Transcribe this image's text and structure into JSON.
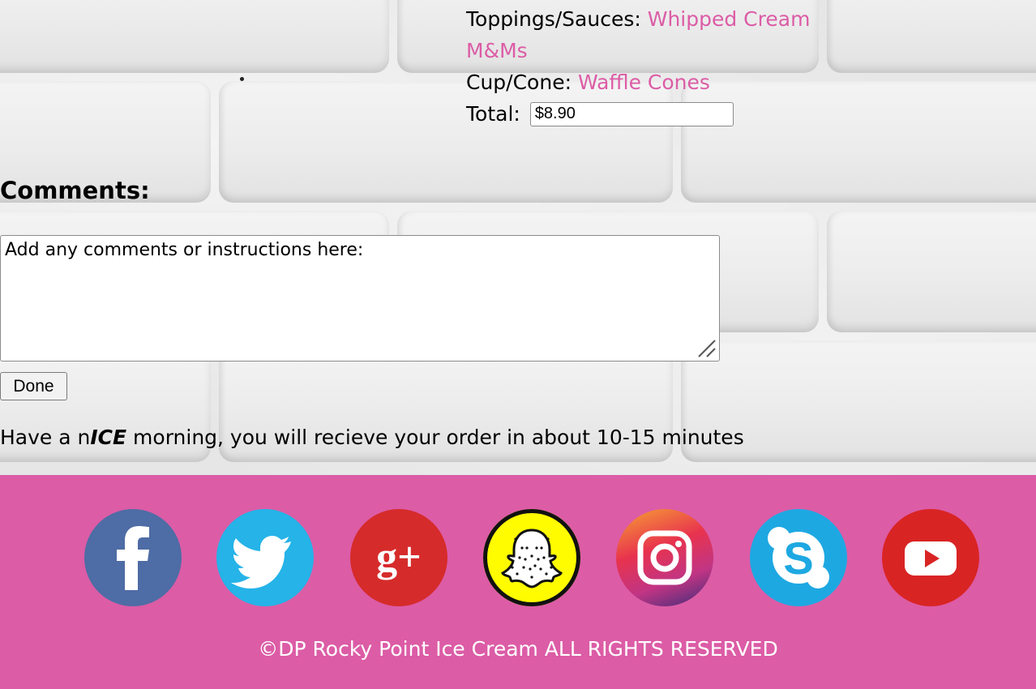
{
  "order": {
    "toppings_label": "Toppings/Sauces:",
    "toppings_value_1": "Whipped Cream",
    "toppings_value_2": "M&Ms",
    "cup_label": "Cup/Cone:",
    "cup_value": "Waffle Cones",
    "total_label": "Total:",
    "total_value": "$8.90"
  },
  "comments": {
    "heading": "Comments:",
    "value": "Add any comments or instructions here:"
  },
  "done_label": "Done",
  "message": {
    "before": "Have a n",
    "emphasis": "ICE",
    "after": " morning, you will recieve your order in about 10-15 minutes"
  },
  "footer": {
    "social": [
      {
        "icon": "facebook-icon",
        "color": "#4e6ca5"
      },
      {
        "icon": "twitter-icon",
        "color": "#25b3e8"
      },
      {
        "icon": "google-plus-icon",
        "color": "#d62b2b"
      },
      {
        "icon": "snapchat-icon",
        "color": "#fffc00"
      },
      {
        "icon": "instagram-icon",
        "color": "#d62e6e"
      },
      {
        "icon": "skype-icon",
        "color": "#1ea8e2"
      },
      {
        "icon": "youtube-icon",
        "color": "#d92424"
      }
    ],
    "copyright": "©DP Rocky Point Ice Cream ALL RIGHTS RESERVED",
    "background": "#dc5ca6"
  }
}
